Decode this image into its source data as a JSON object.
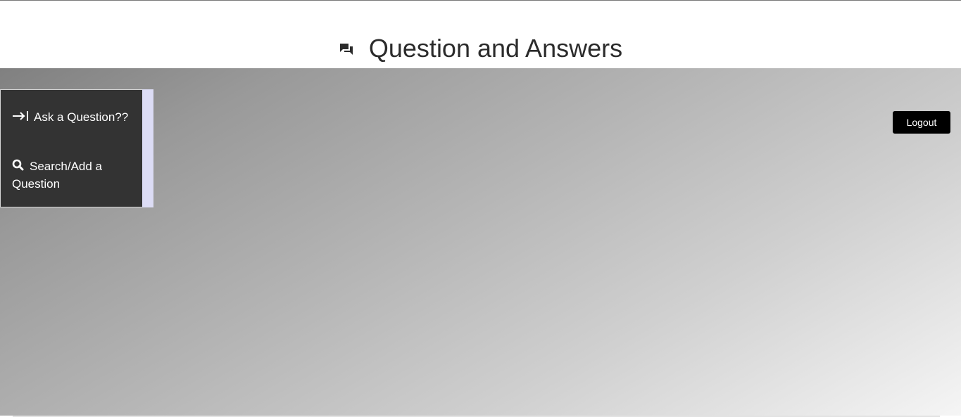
{
  "header": {
    "title": "Question and Answers",
    "icon": "chat-bubbles-icon"
  },
  "sidebar": {
    "items": [
      {
        "label": "Ask a Question??",
        "icon": "arrow-to-right-icon"
      },
      {
        "label": "Search/Add a Question",
        "icon": "search-icon"
      }
    ]
  },
  "toolbar": {
    "logout_label": "Logout"
  },
  "colors": {
    "sidebar_bg": "#333333",
    "sidebar_edge": "#dcdcf5",
    "button_bg": "#000000",
    "gradient_start": "#808080",
    "gradient_end": "#f5f5f5"
  }
}
